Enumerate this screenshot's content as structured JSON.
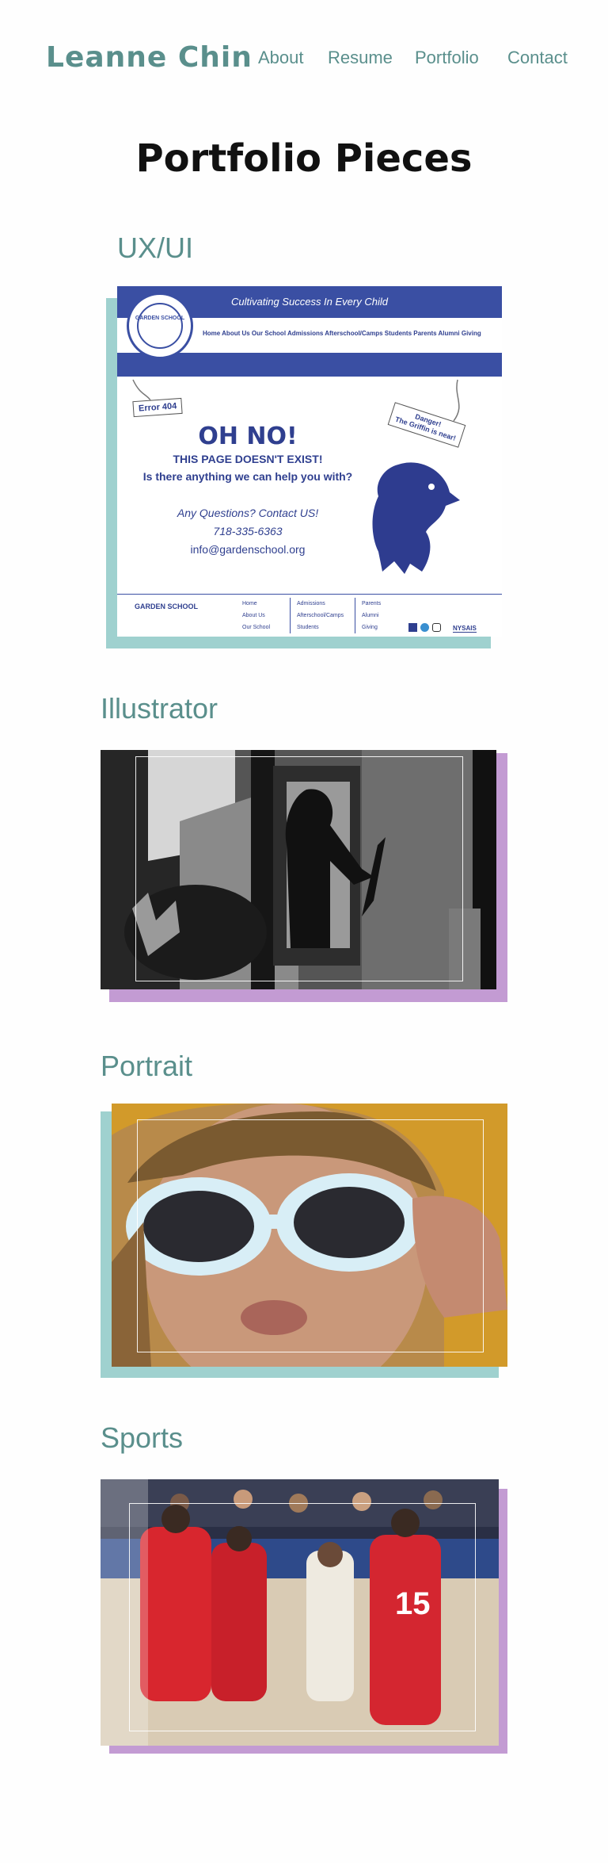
{
  "nav": {
    "brand": "Leanne Chin",
    "links": [
      "About",
      "Resume",
      "Portfolio",
      "Contact"
    ]
  },
  "page_title": "Portfolio Pieces",
  "sections": [
    {
      "title": "UX/UI",
      "shadow_color": "#9fd1cf"
    },
    {
      "title": "Illustrator",
      "shadow_color": "#c39bd3"
    },
    {
      "title": "Portrait",
      "shadow_color": "#9fd1cf"
    },
    {
      "title": "Sports",
      "shadow_color": "#c39bd3"
    }
  ],
  "ux_mockup": {
    "tagline": "Cultivating Success In Every Child",
    "nav_items": "Home   About Us   Our School   Admissions   Afterschool/Camps   Students   Parents   Alumni   Giving",
    "crest_text": "GARDEN SCHOOL",
    "error_tag": "Error 404",
    "danger_tag_line1": "Danger!",
    "danger_tag_line2": "The Griffin is near!",
    "headline": "OH NO!",
    "line1": "THIS PAGE DOESN'T EXIST!",
    "line2": "Is there anything we can help you with?",
    "contact_prompt": "Any Questions? Contact US!",
    "phone": "718-335-6363",
    "email": "info@gardenschool.org",
    "footer_name": "GARDEN SCHOOL",
    "footer_col1": [
      "Home",
      "About Us",
      "Our School"
    ],
    "footer_col2": [
      "Admissions",
      "Afterschool/Camps",
      "Students"
    ],
    "footer_col3": [
      "Parents",
      "Alumni",
      "Giving"
    ],
    "footer_badge": "NYSAIS"
  },
  "colors": {
    "accent": "#5a8f8c",
    "teal_shadow": "#9fd1cf",
    "purple_shadow": "#c39bd3",
    "school_blue": "#3a4fa3"
  }
}
